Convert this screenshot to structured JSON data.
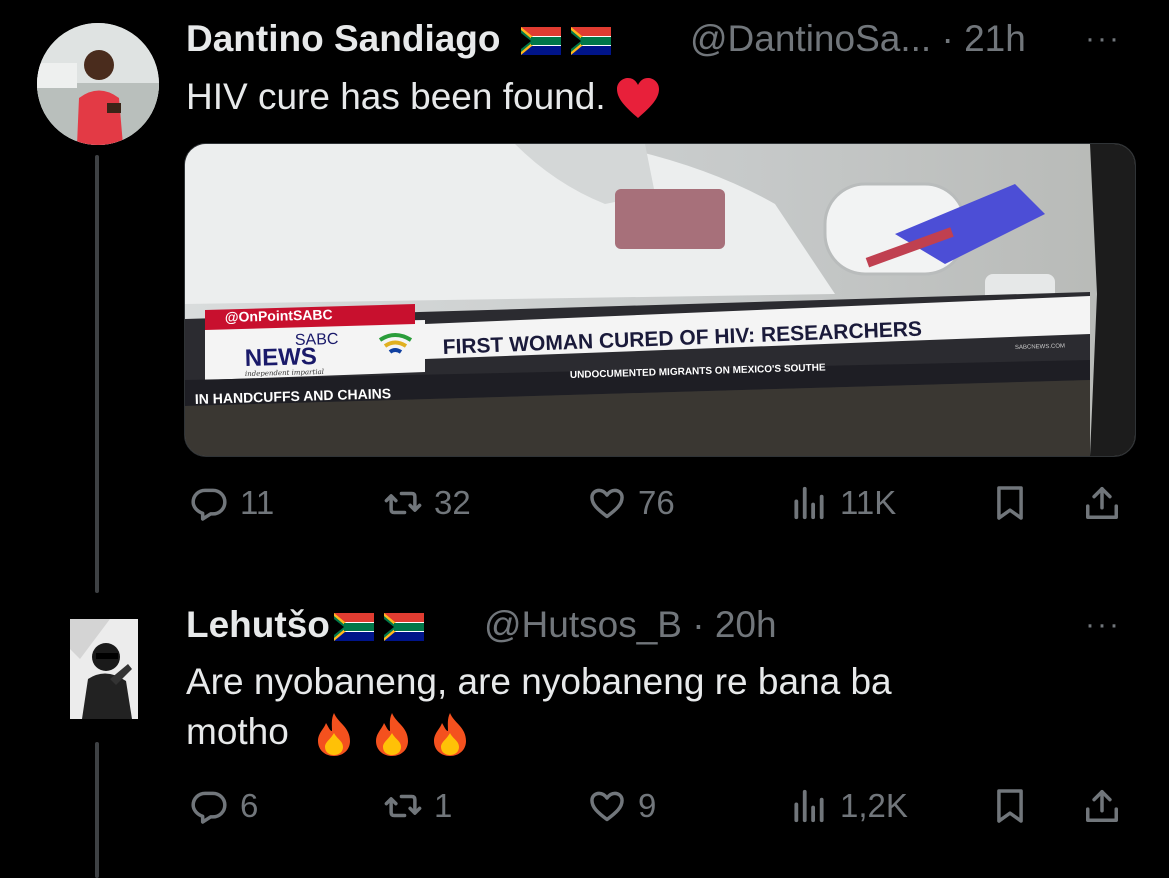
{
  "tweet1": {
    "name": "Dantino Sandiago",
    "handle": "@DantinoSa... · 21h",
    "more": "···",
    "text": "HIV cure has been found.",
    "media": {
      "watermark": "@OnPointSABC",
      "brand_top": "SABC",
      "brand_main": "NEWS",
      "brand_tagline": "independent impartial",
      "headline": "FIRST WOMAN CURED OF HIV: RESEARCHERS",
      "ticker_left": "IN HANDCUFFS AND CHAINS",
      "ticker_right": "UNDOCUMENTED MIGRANTS ON MEXICO'S SOUTHE",
      "ticker_site": "SABCNEWS.COM"
    },
    "replies": "11",
    "retweets": "32",
    "likes": "76",
    "views": "11K"
  },
  "tweet2": {
    "name": "Lehutšo",
    "handle": "@Hutsos_B · 20h",
    "more": "···",
    "text_line1": "Are nyobaneng, are nyobaneng re bana ba",
    "text_line2": "motho",
    "replies": "6",
    "retweets": "1",
    "likes": "9",
    "views": "1,2K"
  },
  "colors": {
    "background": "#000000",
    "text": "#e7e9ea",
    "muted": "#71767b",
    "heart": "#e8203a",
    "sabc_red": "#c8102e"
  },
  "icons": [
    "reply-icon",
    "retweet-icon",
    "like-icon",
    "views-icon",
    "bookmark-icon",
    "share-icon",
    "sa-flag-icon",
    "red-heart-emoji",
    "fire-emoji"
  ]
}
